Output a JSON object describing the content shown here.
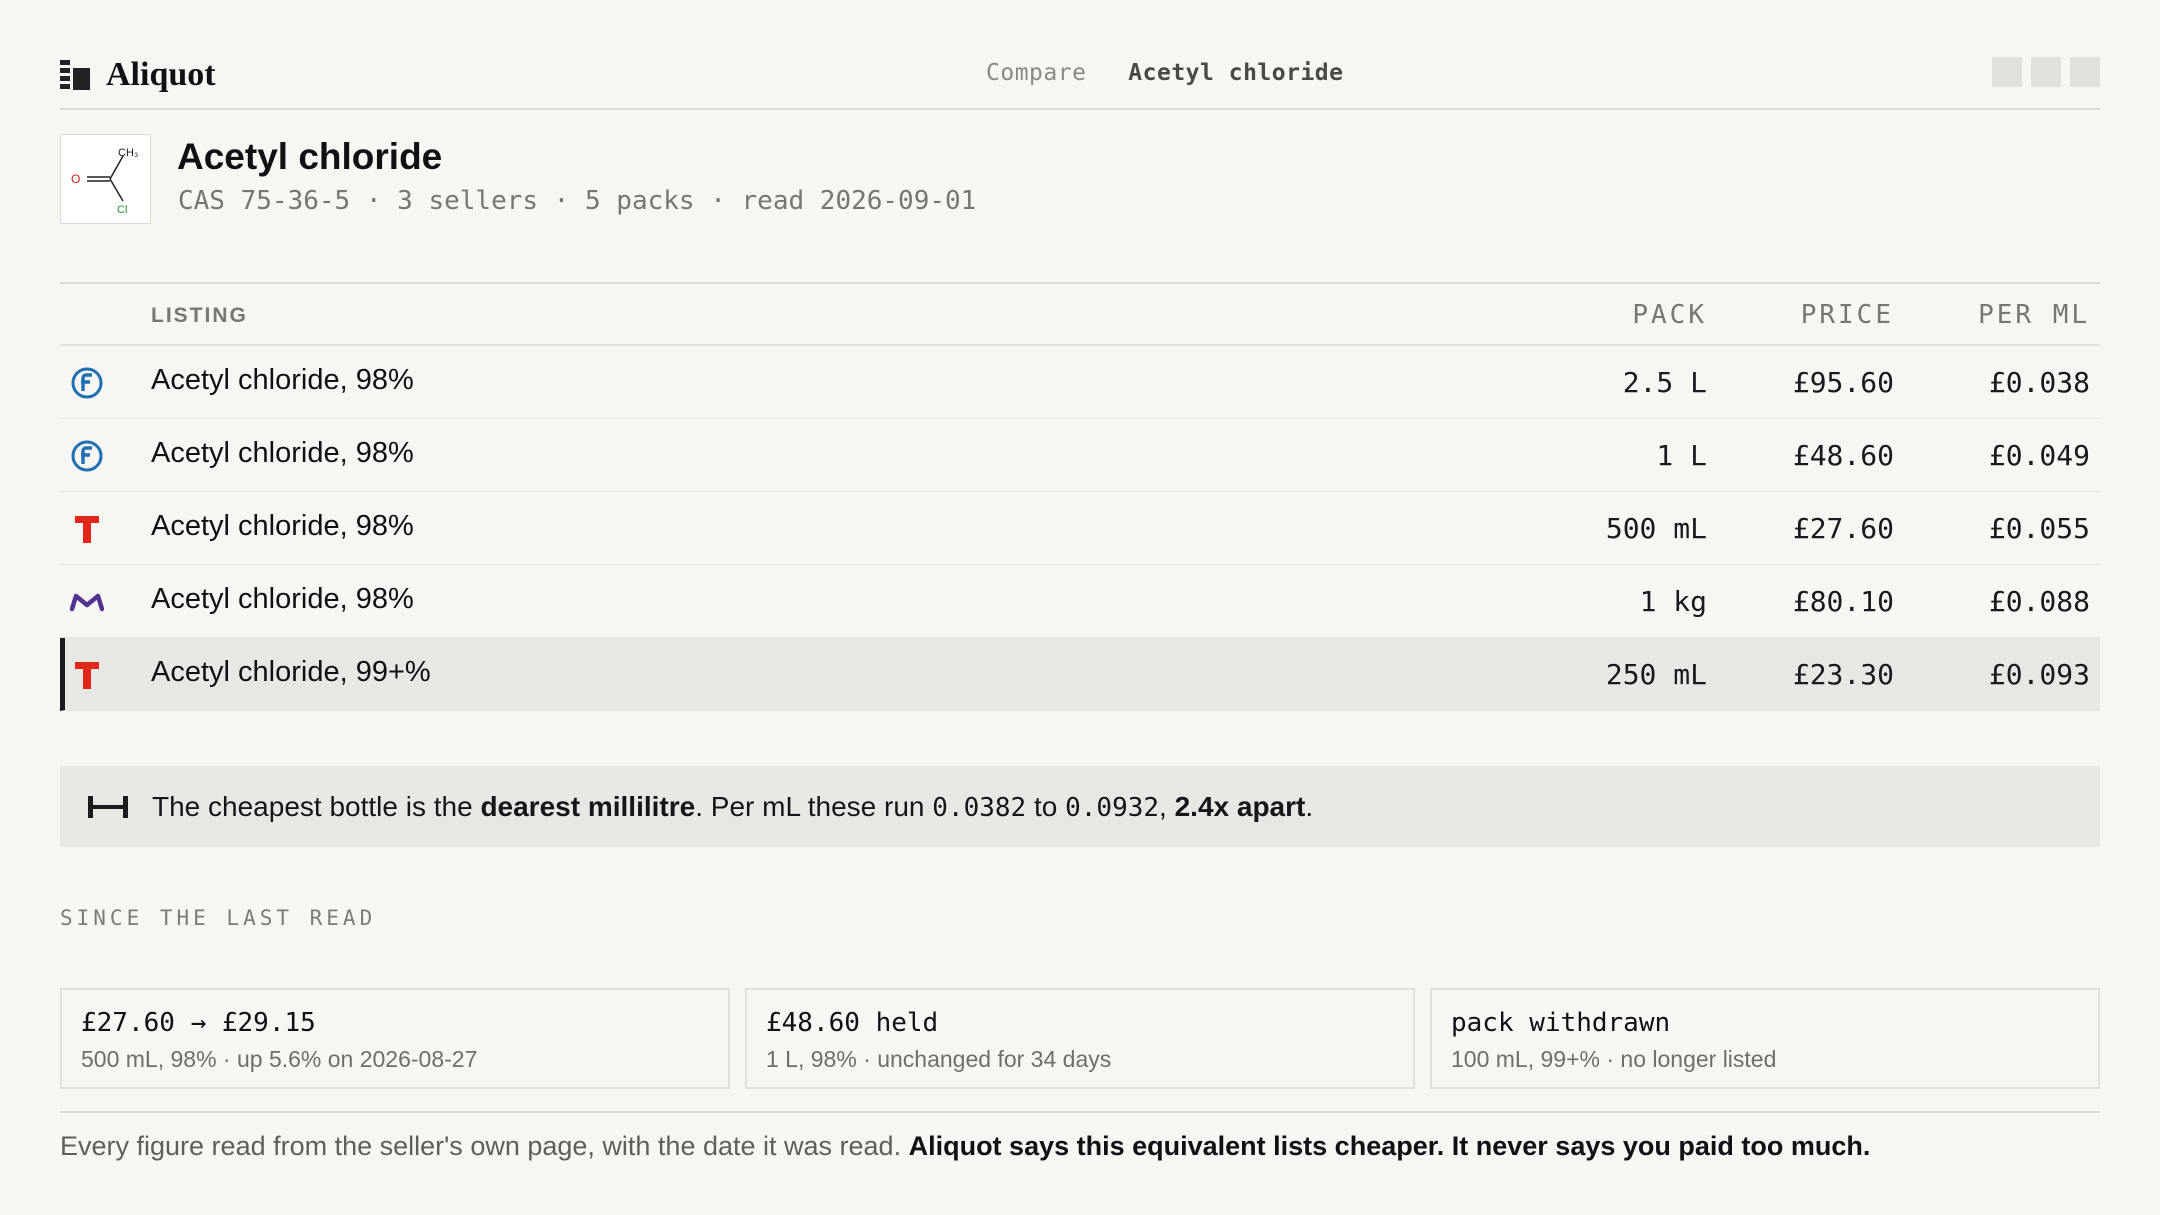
{
  "app": {
    "name": "Aliquot",
    "breadcrumb": {
      "link": "Compare",
      "current": "Acetyl chloride"
    }
  },
  "compound": {
    "title": "Acetyl chloride",
    "meta": "CAS 75-36-5 · 3 sellers · 5 packs · read 2026-09-01",
    "structure": {
      "methyl": "CH₃",
      "oxygen": "O",
      "chlorine": "Cl"
    }
  },
  "table": {
    "headers": {
      "listing": "LISTING",
      "pack": "PACK",
      "price": "PRICE",
      "per_ml": "PER ML"
    },
    "rows": [
      {
        "vendor_icon": "fisher-logo-icon",
        "listing": "Acetyl chloride, 98%",
        "pack": "2.5 L",
        "price": "£95.60",
        "per_ml": "£0.038",
        "selected": false
      },
      {
        "vendor_icon": "fisher-logo-icon",
        "listing": "Acetyl chloride, 98%",
        "pack": "1 L",
        "price": "£48.60",
        "per_ml": "£0.049",
        "selected": false
      },
      {
        "vendor_icon": "tci-logo-icon",
        "listing": "Acetyl chloride, 98%",
        "pack": "500 mL",
        "price": "£27.60",
        "per_ml": "£0.055",
        "selected": false
      },
      {
        "vendor_icon": "merck-logo-icon",
        "listing": "Acetyl chloride, 98%",
        "pack": "1 kg",
        "price": "£80.10",
        "per_ml": "£0.088",
        "selected": false
      },
      {
        "vendor_icon": "tci-logo-icon",
        "listing": "Acetyl chloride, 99+%",
        "pack": "250 mL",
        "price": "£23.30",
        "per_ml": "£0.093",
        "selected": true
      }
    ]
  },
  "insight": {
    "icon": "range-icon",
    "part1": "The cheapest bottle is the ",
    "bold1": "dearest millilitre",
    "part2": ". Per mL these run ",
    "low": "0.0382",
    "part3": " to ",
    "high": "0.0932",
    "part4": ", ",
    "bold2": "2.4x apart",
    "part5": "."
  },
  "since": {
    "label": "SINCE THE LAST READ",
    "cards": [
      {
        "headline": "£27.60 → £29.15",
        "detail": "500 mL, 98% · up 5.6% on 2026-08-27"
      },
      {
        "headline": "£48.60 held",
        "detail": "1 L, 98% · unchanged for 34 days"
      },
      {
        "headline": "pack withdrawn",
        "detail": "100 mL, 99+% · no longer listed"
      }
    ]
  },
  "footer": {
    "normal": "Every figure read from the seller's own page, with the date it was read. ",
    "bold": "Aliquot says this equivalent lists cheaper. It never says you paid too much."
  },
  "colors": {
    "background": "#f7f6f2",
    "highlight": "#e9e7e3",
    "fisher_blue": "#1f6fb4",
    "tci_red": "#e1261c",
    "merck_purple": "#503291",
    "structure_red": "#d42020",
    "structure_green": "#1f9a3a"
  }
}
